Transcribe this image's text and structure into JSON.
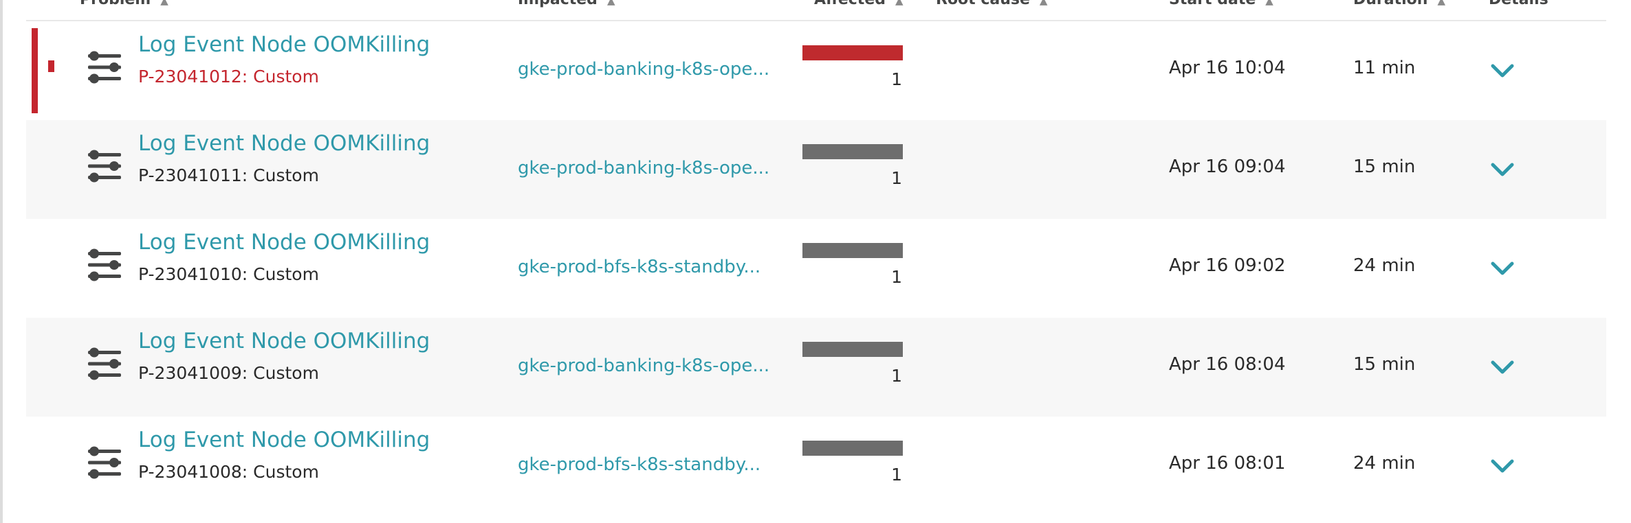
{
  "header": {
    "problem": "Problem",
    "impacted": "Impacted",
    "affected": "Affected",
    "root_cause": "Root cause",
    "start_date": "Start date",
    "duration": "Duration",
    "details": "Details",
    "sort_arrow": "▲"
  },
  "colors": {
    "accent": "#2f99aa",
    "severity_red": "#c4262e",
    "bar_gray": "#6d6d6d",
    "alt_row": "#f7f7f7"
  },
  "icons": {
    "event_type": "sliders-icon",
    "expand": "chevron-down-icon"
  },
  "rows": [
    {
      "title": "Log Event Node OOMKilling",
      "id_text": "P-23041012: Custom",
      "impacted": "gke-prod-banking-k8s-ope...",
      "affected_count": "1",
      "affected_fill": 1.0,
      "affected_color": "#bf2a2e",
      "start": "Apr 16 10:04",
      "duration": "11 min",
      "open": true
    },
    {
      "title": "Log Event Node OOMKilling",
      "id_text": "P-23041011: Custom",
      "impacted": "gke-prod-banking-k8s-ope...",
      "affected_count": "1",
      "affected_fill": 1.0,
      "affected_color": "#6d6d6d",
      "start": "Apr 16 09:04",
      "duration": "15 min",
      "open": false
    },
    {
      "title": "Log Event Node OOMKilling",
      "id_text": "P-23041010: Custom",
      "impacted": "gke-prod-bfs-k8s-standby...",
      "affected_count": "1",
      "affected_fill": 1.0,
      "affected_color": "#6d6d6d",
      "start": "Apr 16 09:02",
      "duration": "24 min",
      "open": false
    },
    {
      "title": "Log Event Node OOMKilling",
      "id_text": "P-23041009: Custom",
      "impacted": "gke-prod-banking-k8s-ope...",
      "affected_count": "1",
      "affected_fill": 1.0,
      "affected_color": "#6d6d6d",
      "start": "Apr 16 08:04",
      "duration": "15 min",
      "open": false
    },
    {
      "title": "Log Event Node OOMKilling",
      "id_text": "P-23041008: Custom",
      "impacted": "gke-prod-bfs-k8s-standby...",
      "affected_count": "1",
      "affected_fill": 1.0,
      "affected_color": "#6d6d6d",
      "start": "Apr 16 08:01",
      "duration": "24 min",
      "open": false
    }
  ]
}
